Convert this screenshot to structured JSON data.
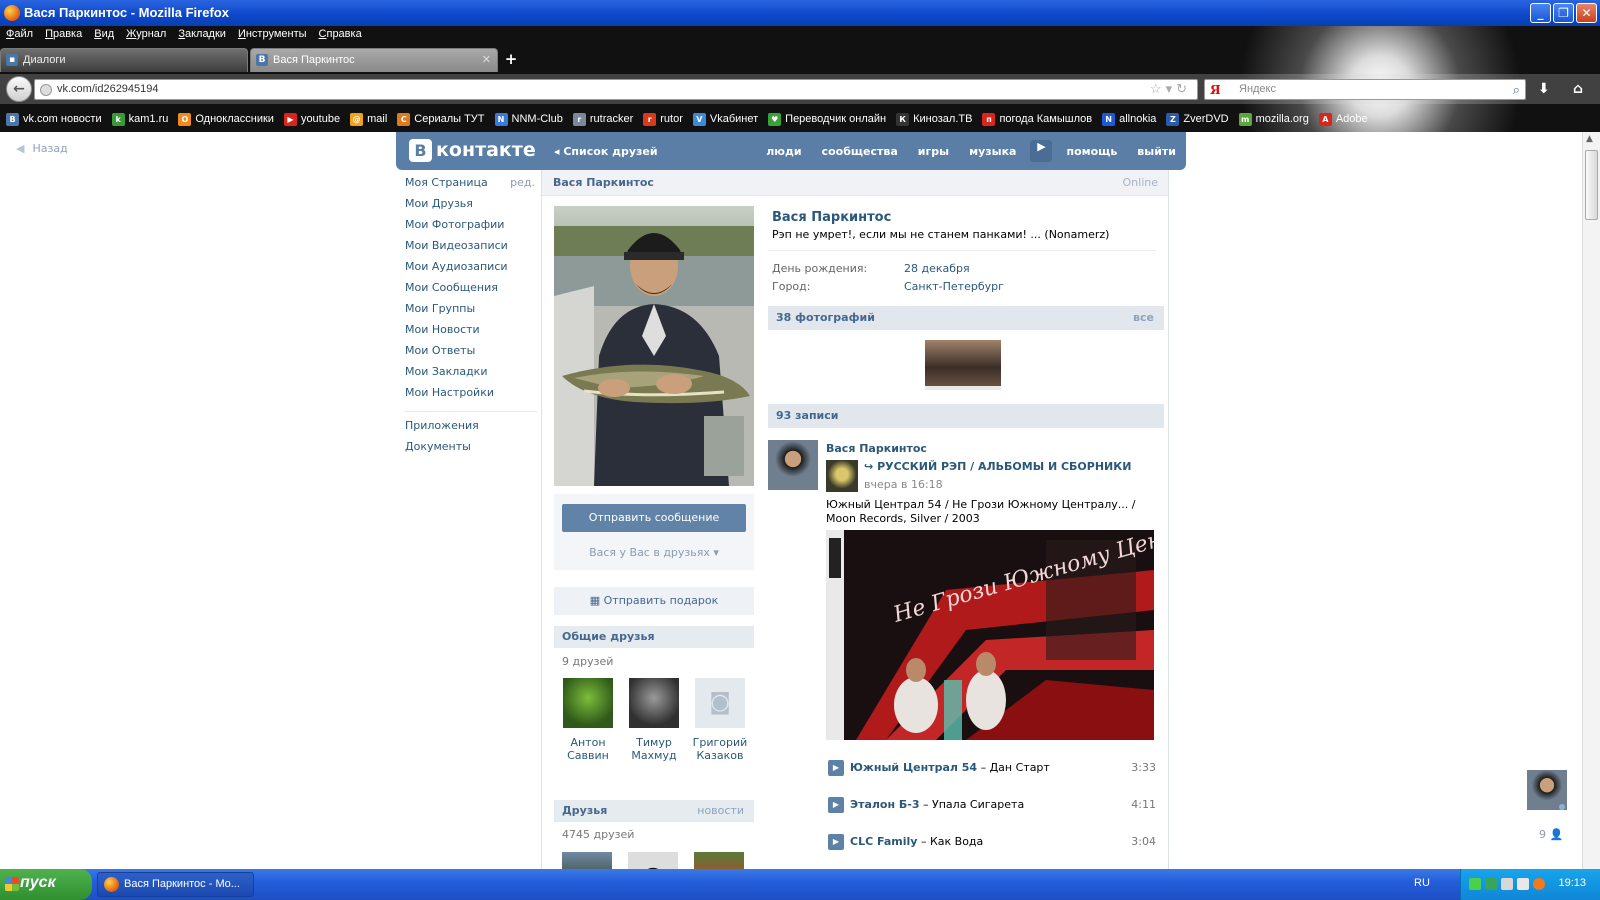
{
  "window": {
    "title": "Вася Паркинтос - Mozilla Firefox"
  },
  "menu": [
    "Файл",
    "Правка",
    "Вид",
    "Журнал",
    "Закладки",
    "Инструменты",
    "Справка"
  ],
  "tabs": [
    {
      "label": "Диалоги"
    },
    {
      "label": "Вася Паркинтос"
    }
  ],
  "address": {
    "url": "vk.com/id262945194"
  },
  "search": {
    "placeholder": "Яндекс"
  },
  "bookmarks": [
    {
      "label": "vk.com новости",
      "color": "#4a76a8",
      "glyph": "В"
    },
    {
      "label": "kam1.ru",
      "color": "#3a9a3a",
      "glyph": "k"
    },
    {
      "label": "Одноклассники",
      "color": "#f08a1c",
      "glyph": "О"
    },
    {
      "label": "youtube",
      "color": "#d8261c",
      "glyph": "▶"
    },
    {
      "label": "mail",
      "color": "#f1a31c",
      "glyph": "@"
    },
    {
      "label": "Сериалы ТУТ",
      "color": "#e07a1c",
      "glyph": "С"
    },
    {
      "label": "NNM-Club",
      "color": "#3a7ad8",
      "glyph": "N"
    },
    {
      "label": "rutracker",
      "color": "#7a8a9a",
      "glyph": "r"
    },
    {
      "label": "rutor",
      "color": "#d83a1c",
      "glyph": "r"
    },
    {
      "label": "Vkабинет",
      "color": "#3a8ad8",
      "glyph": "V"
    },
    {
      "label": "Переводчик онлайн",
      "color": "#3aa03a",
      "glyph": "♥"
    },
    {
      "label": "Кинозал.ТВ",
      "color": "#333333",
      "glyph": "К"
    },
    {
      "label": "погода Камышлов",
      "color": "#d8261c",
      "glyph": "п"
    },
    {
      "label": "allnokia",
      "color": "#1c5ad8",
      "glyph": "N"
    },
    {
      "label": "ZverDVD",
      "color": "#2a5aa8",
      "glyph": "Z"
    },
    {
      "label": "mozilla.org",
      "color": "#5aa83a",
      "glyph": "m"
    },
    {
      "label": "Adobe",
      "color": "#d8261c",
      "glyph": "A"
    }
  ],
  "page": {
    "back_label": "Назад",
    "header": {
      "logo_text": "контакте",
      "logo_letter": "В",
      "crumb": "Список друзей",
      "nav": [
        "люди",
        "сообщества",
        "игры",
        "музыка",
        "помощь",
        "выйти"
      ]
    },
    "left_menu": {
      "items": [
        "Моя Страница",
        "Мои Друзья",
        "Мои Фотографии",
        "Мои Видеозаписи",
        "Мои Аудиозаписи",
        "Мои Сообщения",
        "Мои Группы",
        "Мои Новости",
        "Мои Ответы",
        "Мои Закладки",
        "Мои Настройки"
      ],
      "edit_label": "ред.",
      "extra": [
        "Приложения",
        "Документы"
      ]
    },
    "profile": {
      "name": "Вася Паркинтос",
      "online": "Online",
      "status": "Рэп не умрет!, если мы не станем панками! ... (Nonamerz)",
      "info": [
        {
          "label": "День рождения:",
          "value": "28 декабря"
        },
        {
          "label": "Город:",
          "value": "Санкт-Петербург"
        }
      ],
      "send_message": "Отправить сообщение",
      "friend_status": "Вася у Вас в друзьях",
      "send_gift": "Отправить подарок"
    },
    "common_friends": {
      "title": "Общие друзья",
      "count": "9 друзей",
      "people": [
        {
          "first": "Антон",
          "last": "Саввин"
        },
        {
          "first": "Тимур",
          "last": "Махмуд"
        },
        {
          "first": "Григорий",
          "last": "Казаков"
        }
      ]
    },
    "friends": {
      "title": "Друзья",
      "link": "новости",
      "count": "4745 друзей"
    },
    "photos": {
      "title": "38 фотографий",
      "link": "все"
    },
    "wall": {
      "title": "93 записи",
      "post": {
        "author": "Вася Паркинтос",
        "source": "РУССКИЙ РЭП / АЛЬБОМЫ И СБОРНИКИ",
        "time": "вчера в 16:18",
        "text": "Южный Централ 54 / Не Грози Южному Централу... / Moon Records, Silver / 2003",
        "cover_title": "Не Грози Южному Централу"
      },
      "tracks": [
        {
          "artist": "Южный Централ 54",
          "title": "Дан Старт",
          "duration": "3:33"
        },
        {
          "artist": "Эталон Б-3",
          "title": "Упала Сигарета",
          "duration": "4:11"
        },
        {
          "artist": "CLC Family",
          "title": "Как Вода",
          "duration": "3:04"
        }
      ]
    },
    "chat": {
      "count": "9"
    }
  },
  "taskbar": {
    "start": "пуск",
    "task": "Вася Паркинтос - Mo...",
    "lang": "RU",
    "clock": "19:13"
  }
}
